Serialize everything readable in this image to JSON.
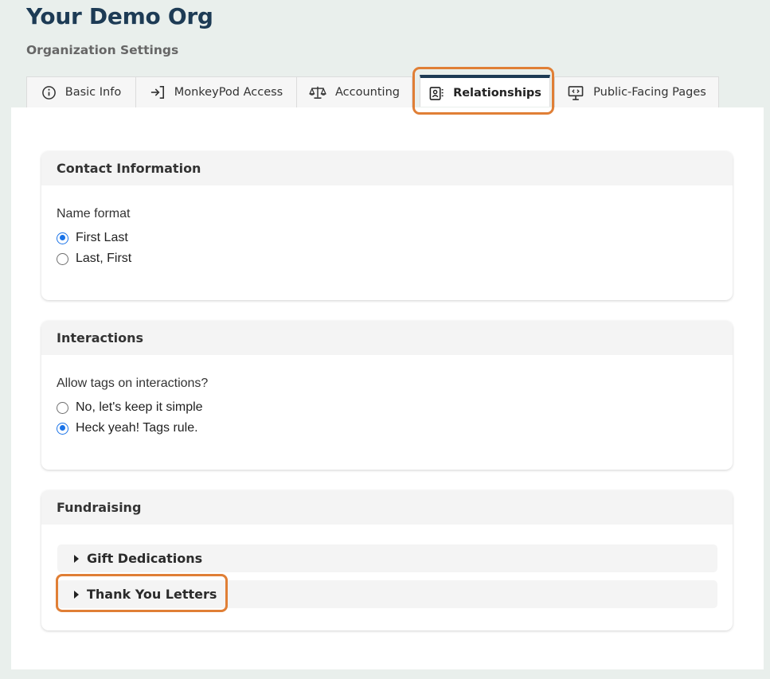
{
  "header": {
    "org_name": "Your Demo Org",
    "subtitle": "Organization Settings"
  },
  "tabs": [
    {
      "label": "Basic Info",
      "icon": "info-icon",
      "active": false
    },
    {
      "label": "MonkeyPod Access",
      "icon": "sign-in-icon",
      "active": false
    },
    {
      "label": "Accounting",
      "icon": "scale-icon",
      "active": false
    },
    {
      "label": "Relationships",
      "icon": "contact-book-icon",
      "active": true
    },
    {
      "label": "Public-Facing Pages",
      "icon": "presentation-icon",
      "active": false
    }
  ],
  "contact_information": {
    "title": "Contact Information",
    "field_label": "Name format",
    "options": [
      {
        "label": "First Last",
        "checked": true
      },
      {
        "label": "Last, First",
        "checked": false
      }
    ]
  },
  "interactions": {
    "title": "Interactions",
    "field_label": "Allow tags on interactions?",
    "options": [
      {
        "label": "No, let's keep it simple",
        "checked": false
      },
      {
        "label": "Heck yeah! Tags rule.",
        "checked": true
      }
    ]
  },
  "fundraising": {
    "title": "Fundraising",
    "sections": [
      {
        "label": "Gift Dedications"
      },
      {
        "label": "Thank You Letters"
      }
    ]
  },
  "colors": {
    "brand": "#1d3b55",
    "highlight": "#e07f36",
    "radio_selected": "#1a73e8"
  }
}
